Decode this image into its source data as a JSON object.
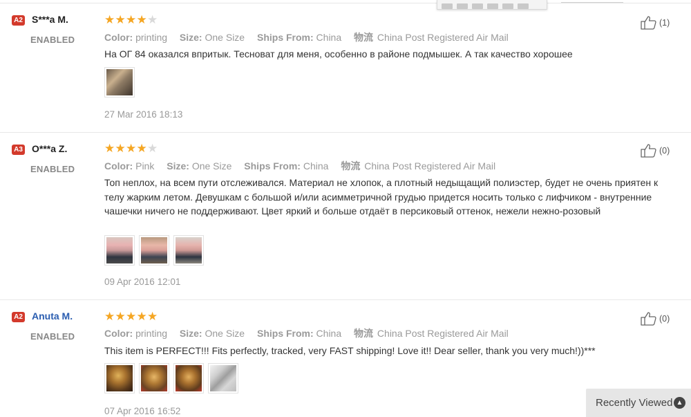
{
  "labels": {
    "color": "Color:",
    "size": "Size:",
    "ships_from": "Ships From:",
    "logistics_cn": "物流"
  },
  "reviews": [
    {
      "level": "A2",
      "name": "S***a M.",
      "status": "ENABLED",
      "rating": 4,
      "color": "printing",
      "size": "One Size",
      "ships_from": "China",
      "logistics": "China Post Registered Air Mail",
      "text": "На ОГ 84 оказался впритык. Тесноват для меня, особенно в районе подмышек. А так качество хорошее",
      "photos": [
        "photo-1"
      ],
      "date": "27 Mar 2016 18:13",
      "useful": "(1)"
    },
    {
      "level": "A3",
      "name": "O***a Z.",
      "status": "ENABLED",
      "rating": 4,
      "color": "Pink",
      "size": "One Size",
      "ships_from": "China",
      "logistics": "China Post Registered Air Mail",
      "text": "Топ неплох, на всем пути отслеживался. Материал не хлопок, а плотный недыщащий полиэстер, будет не очень приятен к телу жарким летом. Девушкам с большой и/или асимметричной грудью придется носить только с лифчиком - внутренние чашечки ничего не поддерживают. Цвет яркий и больше отдаёт в персиковый оттенок, нежели нежно-розовый",
      "photos": [
        "photo-1",
        "photo-2",
        "photo-3"
      ],
      "date": "09 Apr 2016 12:01",
      "useful": "(0)"
    },
    {
      "level": "A2",
      "name": "Anuta M.",
      "status": "ENABLED",
      "rating": 5,
      "color": "printing",
      "size": "One Size",
      "ships_from": "China",
      "logistics": "China Post Registered Air Mail",
      "text": "This item is PERFECT!!! Fits perfectly, tracked, very FAST shipping! Love it!! Dear seller, thank you very much!))***",
      "photos": [
        "photo-1",
        "photo-2",
        "photo-3",
        "photo-4"
      ],
      "date": "07 Apr 2016 16:52",
      "useful": "(0)"
    }
  ],
  "recently_viewed": {
    "label": "Recently Viewed",
    "icon": "chevron-up-icon"
  },
  "colors": {
    "badge": "#d33a2c",
    "star": "#f5a623",
    "link": "#2a5db0"
  }
}
